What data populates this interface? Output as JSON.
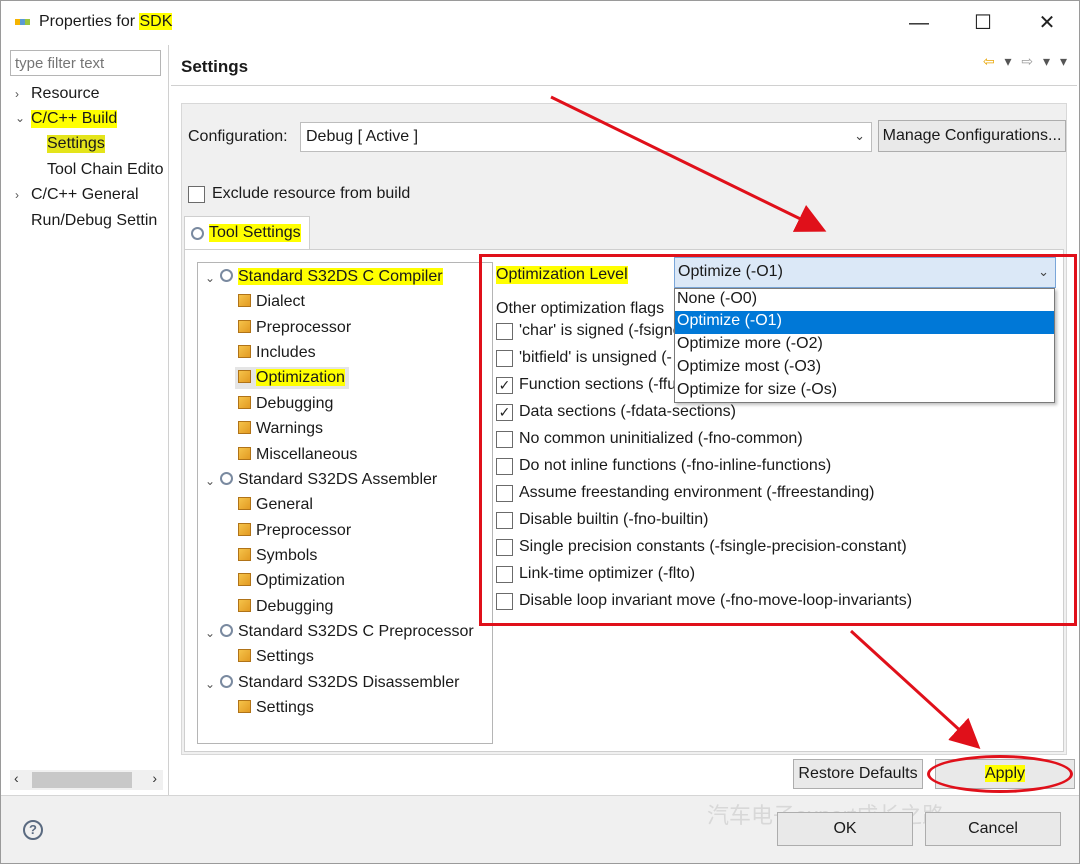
{
  "window": {
    "title_prefix": "Properties for ",
    "title_project": "SDK",
    "controls": {
      "minimize": "—",
      "maximize": "☐",
      "close": "✕"
    }
  },
  "left": {
    "filter_placeholder": "type filter text",
    "items": [
      {
        "label": "Resource",
        "twisty": "›"
      },
      {
        "label": "C/C++ Build",
        "twisty": "⌄"
      },
      {
        "label": "Settings"
      },
      {
        "label": "Tool Chain Edito"
      },
      {
        "label": "C/C++ General",
        "twisty": "›"
      },
      {
        "label": "Run/Debug Settin"
      }
    ],
    "scroll_left": "‹",
    "scroll_right": "›"
  },
  "header": {
    "title": "Settings",
    "nav": {
      "back": "⇦",
      "back_menu": "▾",
      "forward": "⇨",
      "forward_menu": "▾",
      "menu": "▾"
    }
  },
  "config": {
    "label": "Configuration:",
    "value": "Debug  [ Active ]",
    "chevron": "⌄",
    "manage_button": "Manage Configurations...",
    "exclude_label": "Exclude resource from build"
  },
  "tab": {
    "label": "Tool Settings"
  },
  "tree": [
    {
      "label": "Standard S32DS C Compiler",
      "level": 0,
      "icon": "gear-icon",
      "twisty": "⌄"
    },
    {
      "label": "Dialect",
      "level": 1,
      "icon": "page-icon"
    },
    {
      "label": "Preprocessor",
      "level": 1,
      "icon": "page-icon"
    },
    {
      "label": "Includes",
      "level": 1,
      "icon": "page-icon"
    },
    {
      "label": "Optimization",
      "level": 1,
      "icon": "page-icon",
      "selected": true
    },
    {
      "label": "Debugging",
      "level": 1,
      "icon": "page-icon"
    },
    {
      "label": "Warnings",
      "level": 1,
      "icon": "page-icon"
    },
    {
      "label": "Miscellaneous",
      "level": 1,
      "icon": "page-icon"
    },
    {
      "label": "Standard S32DS Assembler",
      "level": 0,
      "icon": "gear-icon",
      "twisty": "⌄"
    },
    {
      "label": "General",
      "level": 1,
      "icon": "page-icon"
    },
    {
      "label": "Preprocessor",
      "level": 1,
      "icon": "page-icon"
    },
    {
      "label": "Symbols",
      "level": 1,
      "icon": "page-icon"
    },
    {
      "label": "Optimization",
      "level": 1,
      "icon": "page-icon"
    },
    {
      "label": "Debugging",
      "level": 1,
      "icon": "page-icon"
    },
    {
      "label": "Standard S32DS C Preprocessor",
      "level": 0,
      "icon": "gear-icon",
      "twisty": "⌄"
    },
    {
      "label": "Settings",
      "level": 1,
      "icon": "page-icon"
    },
    {
      "label": "Standard S32DS Disassembler",
      "level": 0,
      "icon": "gear-icon",
      "twisty": "⌄"
    },
    {
      "label": "Settings",
      "level": 1,
      "icon": "page-icon"
    }
  ],
  "optimization": {
    "level_label": "Optimization Level",
    "level_value": "Optimize (-O1)",
    "chevron": "⌄",
    "other_flags_label": "Other optimization flags",
    "dropdown": [
      {
        "label": "None (-O0)"
      },
      {
        "label": "Optimize (-O1)",
        "selected": true
      },
      {
        "label": "Optimize more (-O2)"
      },
      {
        "label": "Optimize most (-O3)"
      },
      {
        "label": "Optimize for size (-Os)"
      }
    ],
    "flags": [
      {
        "label": "'char' is signed (-fsigne",
        "checked": false
      },
      {
        "label": "'bitfield' is unsigned (-",
        "checked": false
      },
      {
        "label": "Function sections (-ffu",
        "checked": true
      },
      {
        "label": "Data sections (-fdata-sections)",
        "checked": true
      },
      {
        "label": "No common uninitialized (-fno-common)",
        "checked": false
      },
      {
        "label": "Do not inline functions (-fno-inline-functions)",
        "checked": false
      },
      {
        "label": "Assume freestanding environment (-ffreestanding)",
        "checked": false
      },
      {
        "label": "Disable builtin (-fno-builtin)",
        "checked": false
      },
      {
        "label": "Single precision constants (-fsingle-precision-constant)",
        "checked": false
      },
      {
        "label": "Link-time optimizer (-flto)",
        "checked": false
      },
      {
        "label": "Disable loop invariant move (-fno-move-loop-invariants)",
        "checked": false
      }
    ],
    "check_mark": "✓"
  },
  "buttons": {
    "restore_defaults": "Restore Defaults",
    "apply": "Apply",
    "ok": "OK",
    "cancel": "Cancel",
    "help": "?"
  },
  "watermark": "汽车电子expert成长之路",
  "annotation_color": "#e0101a",
  "highlight_color": "#ffff00"
}
